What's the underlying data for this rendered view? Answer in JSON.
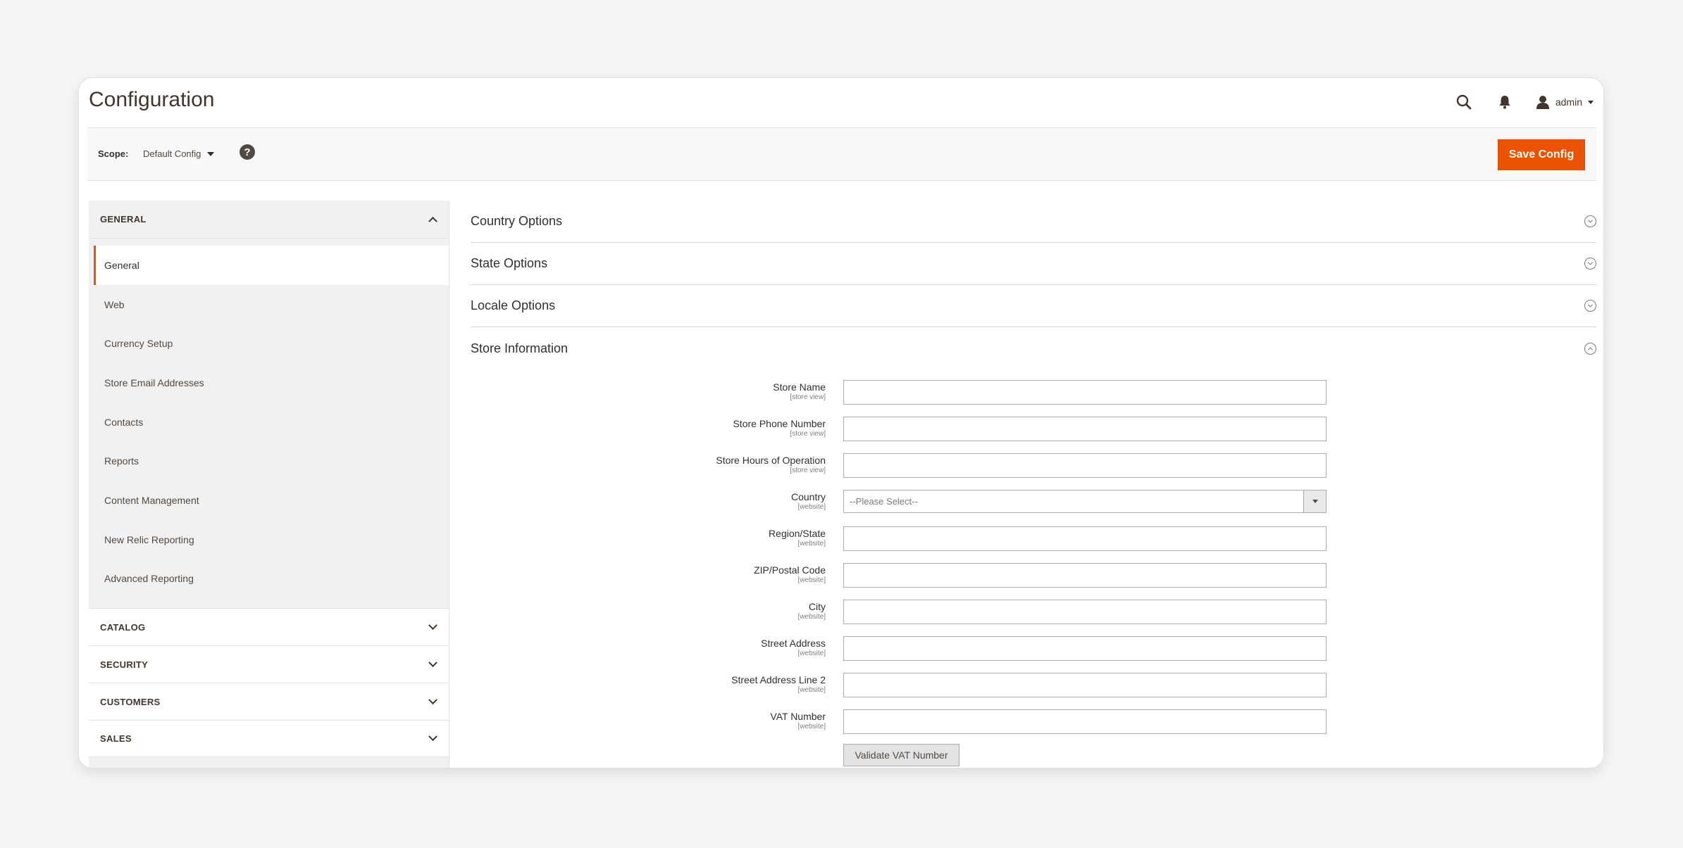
{
  "header": {
    "title": "Configuration",
    "search_icon": "search-icon",
    "notifications_icon": "bell-icon",
    "user_icon": "user-icon",
    "user_name": "admin"
  },
  "scope_bar": {
    "label": "Scope:",
    "value": "Default Config",
    "help_icon": "?",
    "save_label": "Save Config"
  },
  "sidebar": {
    "open_section": "GENERAL",
    "items": [
      {
        "label": "General",
        "active": true
      },
      {
        "label": "Web"
      },
      {
        "label": "Currency Setup"
      },
      {
        "label": "Store Email Addresses"
      },
      {
        "label": "Contacts"
      },
      {
        "label": "Reports"
      },
      {
        "label": "Content Management"
      },
      {
        "label": "New Relic Reporting"
      },
      {
        "label": "Advanced Reporting"
      }
    ],
    "closed_sections": [
      "CATALOG",
      "SECURITY",
      "CUSTOMERS",
      "SALES"
    ]
  },
  "main": {
    "groups": [
      {
        "title": "Country Options"
      },
      {
        "title": "State Options"
      },
      {
        "title": "Locale Options"
      }
    ],
    "store_info": {
      "title": "Store Information",
      "fields": [
        {
          "label": "Store Name",
          "scope": "[store view]",
          "value": ""
        },
        {
          "label": "Store Phone Number",
          "scope": "[store view]",
          "value": ""
        },
        {
          "label": "Store Hours of Operation",
          "scope": "[store view]",
          "value": ""
        },
        {
          "label": "Country",
          "scope": "[website]",
          "value": "--Please Select--"
        },
        {
          "label": "Region/State",
          "scope": "[website]",
          "value": ""
        },
        {
          "label": "ZIP/Postal Code",
          "scope": "[website]",
          "value": ""
        },
        {
          "label": "City",
          "scope": "[website]",
          "value": ""
        },
        {
          "label": "Street Address",
          "scope": "[website]",
          "value": ""
        },
        {
          "label": "Street Address Line 2",
          "scope": "[website]",
          "value": ""
        },
        {
          "label": "VAT Number",
          "scope": "[website]",
          "value": ""
        }
      ],
      "validate_label": "Validate VAT Number"
    }
  },
  "colors": {
    "accent": "#eb5202",
    "sidebar_bg": "#f1f1f1",
    "page_bg": "#f5f5f5"
  }
}
